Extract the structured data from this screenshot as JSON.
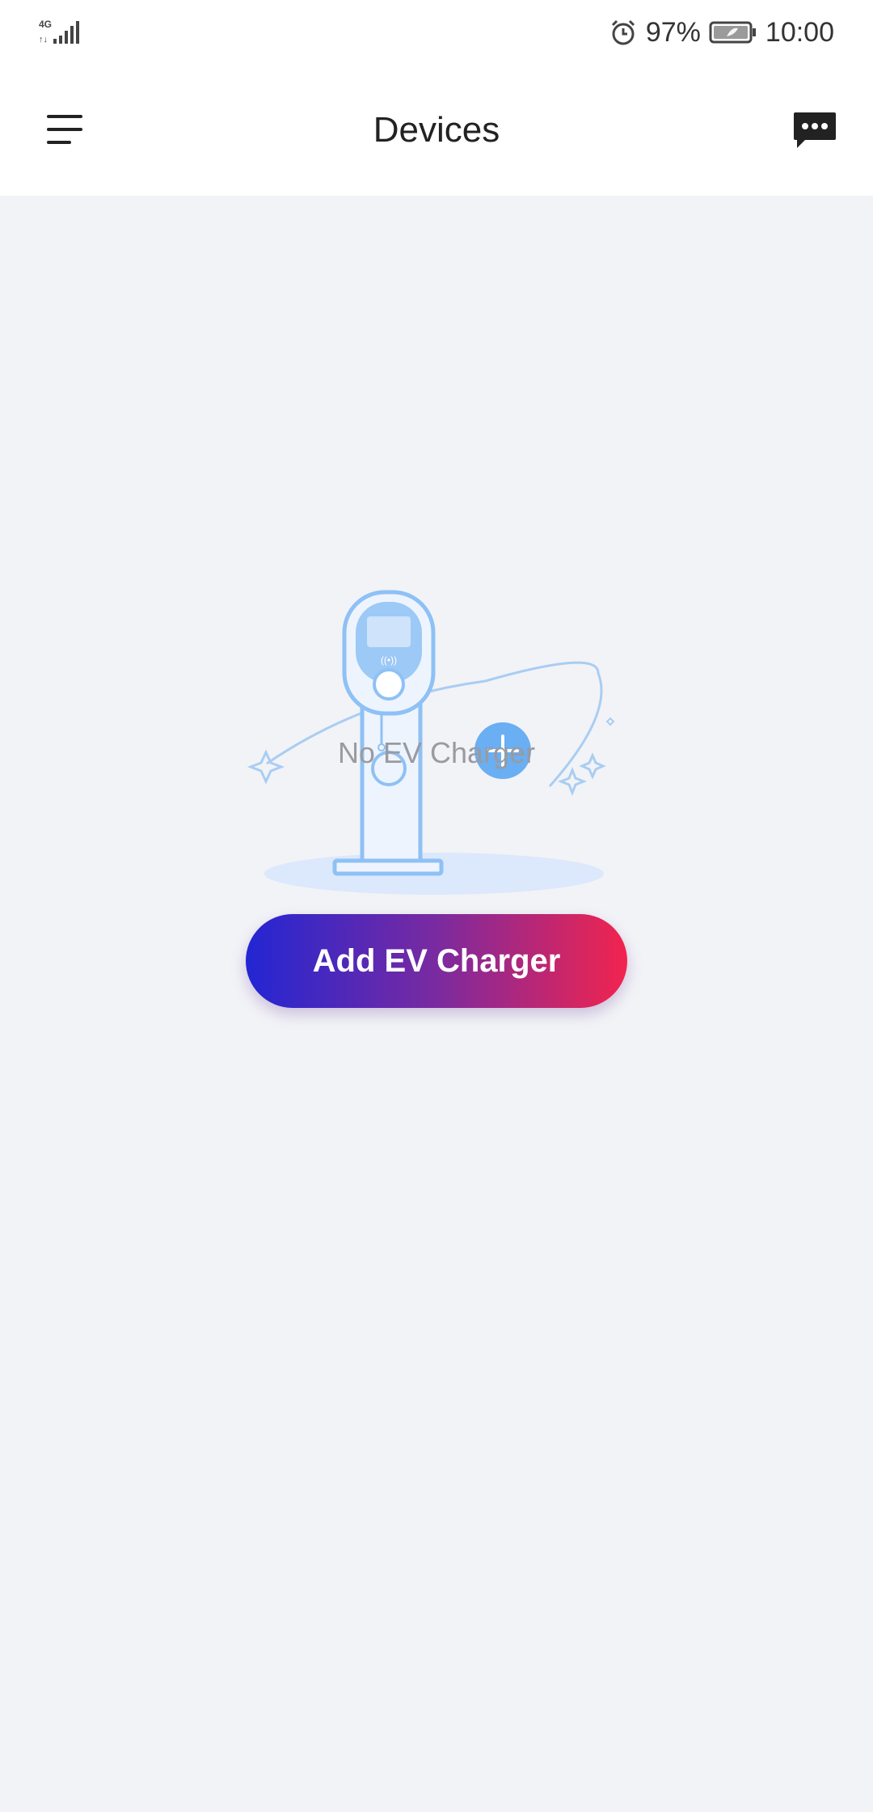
{
  "status_bar": {
    "network": "4G",
    "battery_percent": "97%",
    "time": "10:00",
    "icons": [
      "signal-icon",
      "alarm-icon",
      "battery-icon"
    ]
  },
  "header": {
    "title": "Devices",
    "menu_icon": "hamburger-menu-icon",
    "message_icon": "message-icon"
  },
  "empty_state": {
    "illustration": "ev-charger-illustration",
    "text": "No EV Charger"
  },
  "actions": {
    "add_label": "Add EV Charger"
  },
  "colors": {
    "background": "#f2f3f7",
    "button_gradient_start": "#2326d3",
    "button_gradient_end": "#f2244e",
    "illustration_blue": "#8ec1f5"
  }
}
